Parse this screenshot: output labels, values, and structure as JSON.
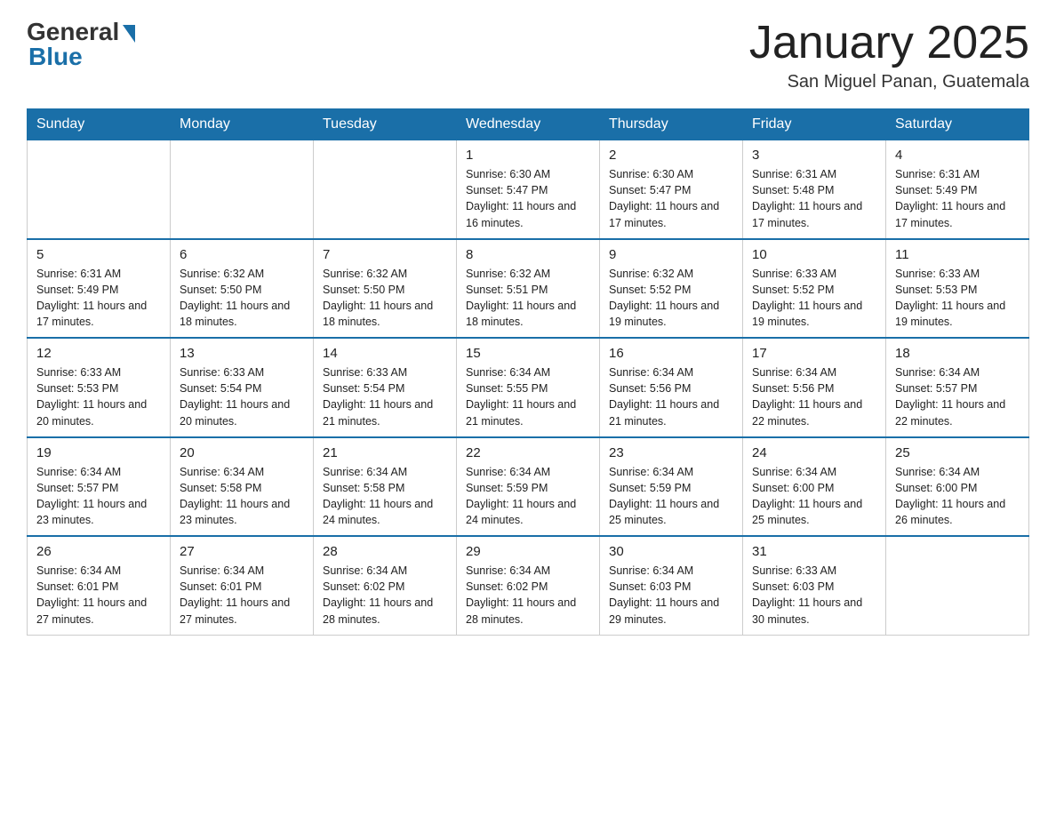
{
  "header": {
    "logo_general": "General",
    "logo_blue": "Blue",
    "month_title": "January 2025",
    "subtitle": "San Miguel Panan, Guatemala"
  },
  "days_of_week": [
    "Sunday",
    "Monday",
    "Tuesday",
    "Wednesday",
    "Thursday",
    "Friday",
    "Saturday"
  ],
  "weeks": [
    [
      {
        "day": "",
        "info": ""
      },
      {
        "day": "",
        "info": ""
      },
      {
        "day": "",
        "info": ""
      },
      {
        "day": "1",
        "info": "Sunrise: 6:30 AM\nSunset: 5:47 PM\nDaylight: 11 hours and 16 minutes."
      },
      {
        "day": "2",
        "info": "Sunrise: 6:30 AM\nSunset: 5:47 PM\nDaylight: 11 hours and 17 minutes."
      },
      {
        "day": "3",
        "info": "Sunrise: 6:31 AM\nSunset: 5:48 PM\nDaylight: 11 hours and 17 minutes."
      },
      {
        "day": "4",
        "info": "Sunrise: 6:31 AM\nSunset: 5:49 PM\nDaylight: 11 hours and 17 minutes."
      }
    ],
    [
      {
        "day": "5",
        "info": "Sunrise: 6:31 AM\nSunset: 5:49 PM\nDaylight: 11 hours and 17 minutes."
      },
      {
        "day": "6",
        "info": "Sunrise: 6:32 AM\nSunset: 5:50 PM\nDaylight: 11 hours and 18 minutes."
      },
      {
        "day": "7",
        "info": "Sunrise: 6:32 AM\nSunset: 5:50 PM\nDaylight: 11 hours and 18 minutes."
      },
      {
        "day": "8",
        "info": "Sunrise: 6:32 AM\nSunset: 5:51 PM\nDaylight: 11 hours and 18 minutes."
      },
      {
        "day": "9",
        "info": "Sunrise: 6:32 AM\nSunset: 5:52 PM\nDaylight: 11 hours and 19 minutes."
      },
      {
        "day": "10",
        "info": "Sunrise: 6:33 AM\nSunset: 5:52 PM\nDaylight: 11 hours and 19 minutes."
      },
      {
        "day": "11",
        "info": "Sunrise: 6:33 AM\nSunset: 5:53 PM\nDaylight: 11 hours and 19 minutes."
      }
    ],
    [
      {
        "day": "12",
        "info": "Sunrise: 6:33 AM\nSunset: 5:53 PM\nDaylight: 11 hours and 20 minutes."
      },
      {
        "day": "13",
        "info": "Sunrise: 6:33 AM\nSunset: 5:54 PM\nDaylight: 11 hours and 20 minutes."
      },
      {
        "day": "14",
        "info": "Sunrise: 6:33 AM\nSunset: 5:54 PM\nDaylight: 11 hours and 21 minutes."
      },
      {
        "day": "15",
        "info": "Sunrise: 6:34 AM\nSunset: 5:55 PM\nDaylight: 11 hours and 21 minutes."
      },
      {
        "day": "16",
        "info": "Sunrise: 6:34 AM\nSunset: 5:56 PM\nDaylight: 11 hours and 21 minutes."
      },
      {
        "day": "17",
        "info": "Sunrise: 6:34 AM\nSunset: 5:56 PM\nDaylight: 11 hours and 22 minutes."
      },
      {
        "day": "18",
        "info": "Sunrise: 6:34 AM\nSunset: 5:57 PM\nDaylight: 11 hours and 22 minutes."
      }
    ],
    [
      {
        "day": "19",
        "info": "Sunrise: 6:34 AM\nSunset: 5:57 PM\nDaylight: 11 hours and 23 minutes."
      },
      {
        "day": "20",
        "info": "Sunrise: 6:34 AM\nSunset: 5:58 PM\nDaylight: 11 hours and 23 minutes."
      },
      {
        "day": "21",
        "info": "Sunrise: 6:34 AM\nSunset: 5:58 PM\nDaylight: 11 hours and 24 minutes."
      },
      {
        "day": "22",
        "info": "Sunrise: 6:34 AM\nSunset: 5:59 PM\nDaylight: 11 hours and 24 minutes."
      },
      {
        "day": "23",
        "info": "Sunrise: 6:34 AM\nSunset: 5:59 PM\nDaylight: 11 hours and 25 minutes."
      },
      {
        "day": "24",
        "info": "Sunrise: 6:34 AM\nSunset: 6:00 PM\nDaylight: 11 hours and 25 minutes."
      },
      {
        "day": "25",
        "info": "Sunrise: 6:34 AM\nSunset: 6:00 PM\nDaylight: 11 hours and 26 minutes."
      }
    ],
    [
      {
        "day": "26",
        "info": "Sunrise: 6:34 AM\nSunset: 6:01 PM\nDaylight: 11 hours and 27 minutes."
      },
      {
        "day": "27",
        "info": "Sunrise: 6:34 AM\nSunset: 6:01 PM\nDaylight: 11 hours and 27 minutes."
      },
      {
        "day": "28",
        "info": "Sunrise: 6:34 AM\nSunset: 6:02 PM\nDaylight: 11 hours and 28 minutes."
      },
      {
        "day": "29",
        "info": "Sunrise: 6:34 AM\nSunset: 6:02 PM\nDaylight: 11 hours and 28 minutes."
      },
      {
        "day": "30",
        "info": "Sunrise: 6:34 AM\nSunset: 6:03 PM\nDaylight: 11 hours and 29 minutes."
      },
      {
        "day": "31",
        "info": "Sunrise: 6:33 AM\nSunset: 6:03 PM\nDaylight: 11 hours and 30 minutes."
      },
      {
        "day": "",
        "info": ""
      }
    ]
  ]
}
